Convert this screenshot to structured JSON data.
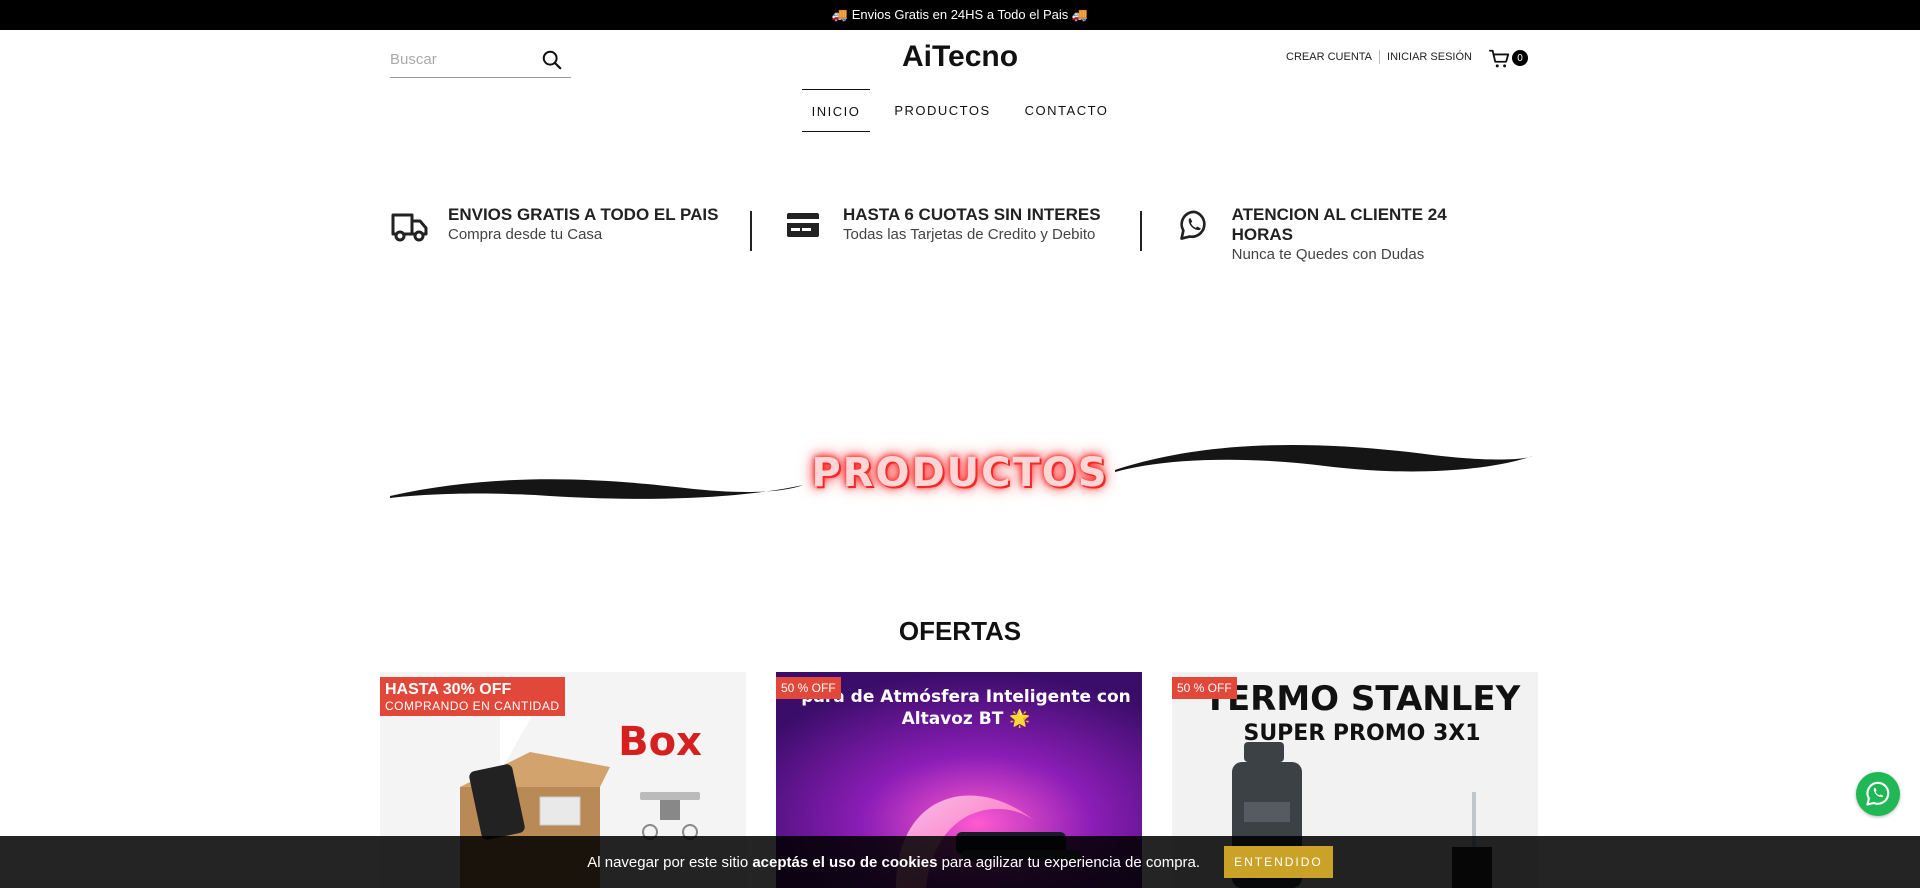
{
  "announcement": "🚚 Envios Gratis en 24HS a Todo el Pais 🚚",
  "search": {
    "placeholder": "Buscar",
    "icon": "search-icon"
  },
  "logo": "AiTecno",
  "account": {
    "create": "Crear cuenta",
    "login": "Iniciar sesión"
  },
  "cart": {
    "count": "0",
    "icon": "cart-icon"
  },
  "nav": [
    {
      "label": "INICIO",
      "active": true
    },
    {
      "label": "PRODUCTOS",
      "active": false
    },
    {
      "label": "CONTACTO",
      "active": false
    }
  ],
  "features": [
    {
      "icon": "truck-icon",
      "title": "ENVIOS GRATIS A TODO EL PAIS",
      "subtitle": "Compra desde tu Casa"
    },
    {
      "icon": "credit-card-icon",
      "title": "HASTA 6 CUOTAS SIN INTERES",
      "subtitle": "Todas las Tarjetas de Credito y Debito"
    },
    {
      "icon": "whatsapp-icon",
      "title": "ATENCION AL CLIENTE 24 HORAS",
      "subtitle": "Nunca te Quedes con Dudas"
    }
  ],
  "banner": {
    "text": "PRODUCTOS",
    "glow_color": "#ff2a2a"
  },
  "ofertas_title": "OFERTAS",
  "products": [
    {
      "tag_line1": "HASTA 30% OFF",
      "tag_line2": "COMPRANDO EN CANTIDAD",
      "image_text": "Box"
    },
    {
      "tag": "50 % OFF",
      "image_text": "para de Atmósfera Inteligente con Altavoz BT 🌟"
    },
    {
      "tag": "50 % OFF",
      "image_line1": "TERMO STANLEY",
      "image_line2": "SUPER PROMO 3X1"
    }
  ],
  "cookie": {
    "prefix": "Al navegar por este sitio",
    "bold": "aceptás el uso de cookies",
    "suffix": "para agilizar tu experiencia de compra.",
    "button": "ENTENDIDO"
  },
  "colors": {
    "accent": "#e2483a",
    "cookie_button": "#c9a227",
    "whatsapp": "#1fb855"
  }
}
